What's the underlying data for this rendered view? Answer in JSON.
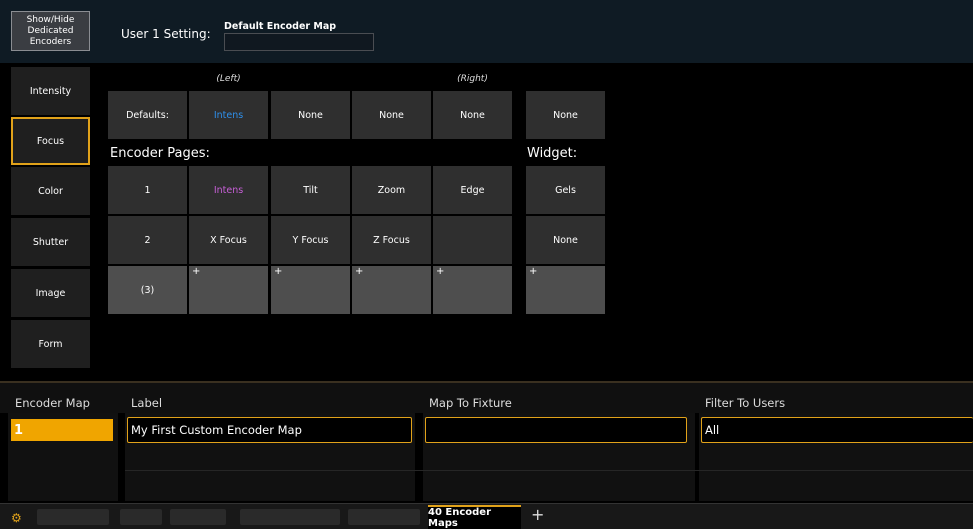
{
  "top": {
    "show_hide": "Show/Hide\nDedicated\nEncoders",
    "user_setting": "User 1 Setting:",
    "default_map_title": "Default Encoder Map"
  },
  "categories": [
    "Intensity",
    "Focus",
    "Color",
    "Shutter",
    "Image",
    "Form"
  ],
  "selected_category": "Focus",
  "grid": {
    "left_header": "(Left)",
    "right_header": "(Right)",
    "defaults_label": "Defaults:",
    "defaults": [
      "Intens",
      "None",
      "None",
      "None"
    ],
    "defaults_widget": "None",
    "encoder_pages_title": "Encoder Pages:",
    "widget_title": "Widget:",
    "pages": [
      {
        "label": "1",
        "cells": [
          "Intens",
          "Tilt",
          "Zoom",
          "Edge"
        ],
        "widget": "Gels"
      },
      {
        "label": "2",
        "cells": [
          "X Focus",
          "Y Focus",
          "Z Focus",
          ""
        ],
        "widget": "None"
      },
      {
        "label": "(3)",
        "cells": [
          "+",
          "+",
          "+",
          "+"
        ],
        "widget": "+"
      }
    ]
  },
  "table": {
    "headers": [
      "Encoder Map",
      "Label",
      "Map To Fixture",
      "Filter To Users"
    ],
    "row": {
      "number": "1",
      "label": "My First Custom Encoder Map",
      "fixture": "",
      "users": "All"
    }
  },
  "tabs": {
    "active": "40 Encoder Maps",
    "add": "+"
  },
  "colors": {
    "accent": "#e1a21a",
    "intens_blue": "#2f8fea",
    "intens_magenta": "#c65fd6"
  }
}
